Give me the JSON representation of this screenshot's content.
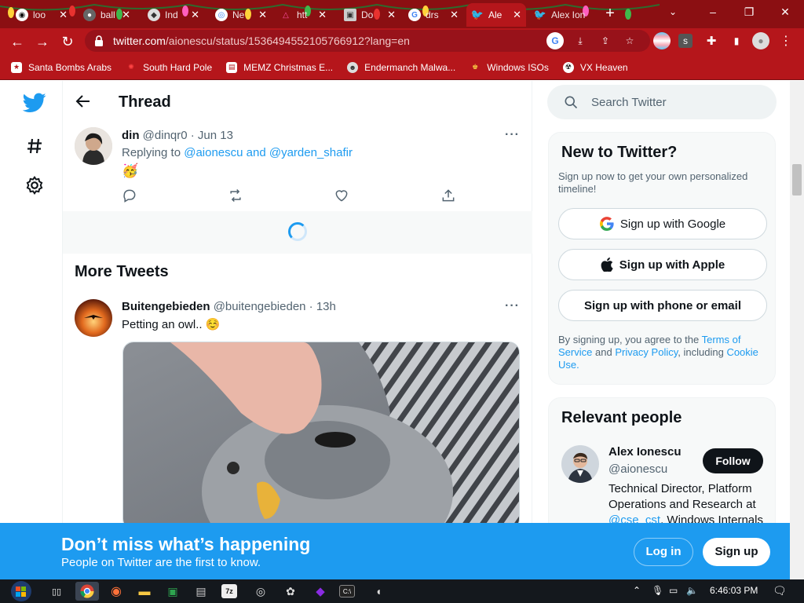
{
  "browser": {
    "tabs": [
      {
        "label": "loo",
        "icon": "github-icon"
      },
      {
        "label": "ball",
        "icon": "globe-icon"
      },
      {
        "label": "Ind",
        "icon": "bookmark-icon"
      },
      {
        "label": "Ne",
        "icon": "chrome-icon"
      },
      {
        "label": "htt",
        "icon": "alert-icon"
      },
      {
        "label": "Do",
        "icon": "page-icon"
      },
      {
        "label": "drs",
        "icon": "google-icon"
      },
      {
        "label": "Ale",
        "icon": "twitter-icon",
        "active": true
      },
      {
        "label": "Alex Ion",
        "icon": "twitter-icon"
      }
    ],
    "url": "twitter.com/aionescu/status/1536494552105766912?lang=en",
    "url_host": "twitter.com",
    "url_path": "/aionescu/status/1536494552105766912?lang=en",
    "bookmarks": [
      "Santa Bombs Arabs",
      "South Hard Pole",
      "MEMZ Christmas E...",
      "Endermanch Malwa...",
      "Windows ISOs",
      "VX Heaven"
    ]
  },
  "twitter": {
    "header_title": "Thread",
    "reply_tweet": {
      "name": "din",
      "meta": "@dinqr0 · Jun 13",
      "replying_prefix": "Replying to",
      "replying_targets": "@aionescu and @yarden_shafir",
      "emoji": "🥳"
    },
    "more_tweets_title": "More Tweets",
    "more_tweet": {
      "name": "Buitengebieden",
      "meta": "@buitengebieden · 13h",
      "text": "Petting an owl.. ☺️"
    },
    "search_placeholder": "Search Twitter",
    "new_card": {
      "title": "New to Twitter?",
      "desc": "Sign up now to get your own personalized timeline!",
      "google": "Sign up with Google",
      "apple": "Sign up with Apple",
      "phone": "Sign up with phone or email",
      "legal_1": "By signing up, you agree to the",
      "legal_terms": "Terms of Service",
      "legal_and": "and",
      "legal_privacy": "Privacy Policy",
      "legal_incl": ", including",
      "legal_cookie": "Cookie Use."
    },
    "people_card": {
      "title": "Relevant people",
      "name": "Alex Ionescu",
      "handle": "@aionescu",
      "follow": "Follow",
      "bio_1": "Technical Director, Platform",
      "bio_2": "Operations and Research at",
      "bio_3a": "@cse_cst",
      "bio_3b": ", Windows Internals"
    },
    "bottom_bar": {
      "headline": "Don’t miss what’s happening",
      "sub": "People on Twitter are the first to know.",
      "login": "Log in",
      "signup": "Sign up"
    }
  },
  "taskbar": {
    "time": "6:46:03 PM"
  },
  "colors": {
    "twitter_blue": "#1d9bf0",
    "chrome_red": "#b5161b",
    "tabstrip_dark_red": "#8b0f12"
  }
}
